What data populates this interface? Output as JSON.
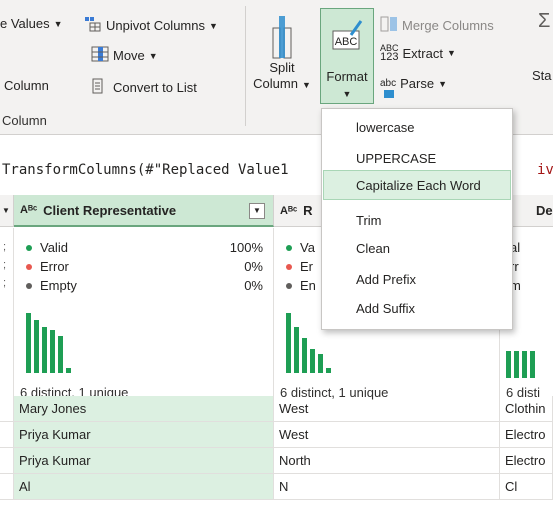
{
  "ribbon": {
    "replace_values": "e Values",
    "unpivot_columns": "Unpivot Columns",
    "move": "Move",
    "convert_to_list": "Convert to List",
    "column_cut": "Column",
    "group_label": "Column",
    "split_column_line1": "Split",
    "split_column_line2": "Column",
    "format": "Format",
    "merge_columns": "Merge Columns",
    "extract": "Extract",
    "parse": "Parse",
    "stats_cut": "Sta",
    "abc_icon": "ABC",
    "num_icon_top": "ABC",
    "num_icon_bottom": "123",
    "parse_icon": "abc"
  },
  "formula": {
    "text": "TransformColumns(#\"Replaced Value1",
    "overflow": "iv"
  },
  "format_menu": {
    "items": [
      {
        "label": "lowercase"
      },
      {
        "label": "UPPERCASE"
      },
      {
        "label": "Capitalize Each Word"
      },
      {
        "label": "Trim"
      },
      {
        "label": "Clean"
      },
      {
        "label": "Add Prefix"
      },
      {
        "label": "Add Suffix"
      }
    ],
    "highlighted_index": 2
  },
  "grid": {
    "columns": [
      {
        "type_icon": "Aᴮᶜ",
        "name": "Client Representative",
        "valid_label": "Valid",
        "valid_pct": "100%",
        "error_label": "Error",
        "error_pct": "0%",
        "empty_label": "Empty",
        "empty_pct": "0%",
        "distinct": "6 distinct, 1 unique",
        "bar_levels": [
          1.0,
          0.88,
          0.76,
          0.72,
          0.62,
          0.09
        ]
      },
      {
        "type_icon": "Aᴮᶜ",
        "name": "R",
        "valid_label": "Va",
        "error_label": "Er",
        "empty_label": "En",
        "distinct": "6 distinct, 1 unique",
        "bar_levels": [
          1.0,
          0.77,
          0.58,
          0.4,
          0.31,
          0.09
        ]
      },
      {
        "name": "De",
        "valid_label": "al",
        "error_label": "rr",
        "empty_label": "m",
        "distinct": "6 disti"
      }
    ],
    "rows": [
      [
        "Mary Jones",
        "West",
        "Clothin"
      ],
      [
        "Priya Kumar",
        "West",
        "Electro"
      ],
      [
        "Priya Kumar",
        "North",
        "Electro"
      ],
      [
        "Al",
        "N",
        "Cl"
      ]
    ]
  },
  "colors": {
    "accent_green": "#1e9e54",
    "error_red": "#e8584f",
    "empty_grey": "#605e5c",
    "selected_header": "#cde8d4",
    "selected_cell": "#dcf0e1"
  }
}
